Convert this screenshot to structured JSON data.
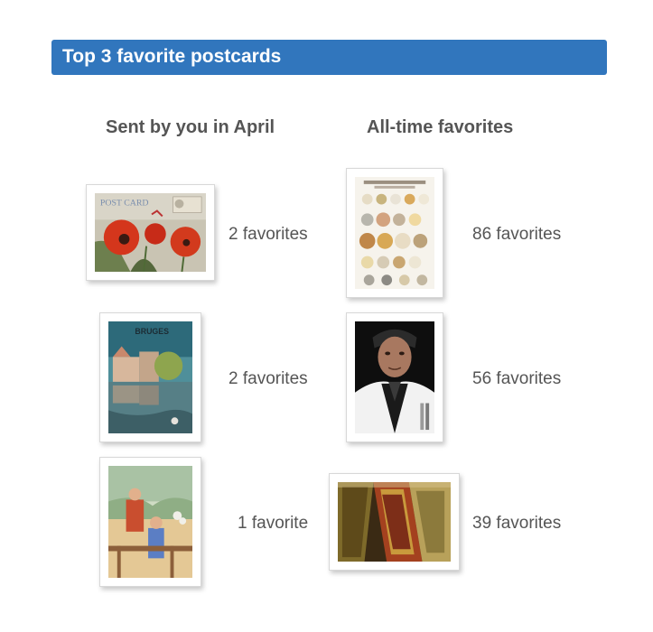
{
  "section": {
    "title": "Top 3 favorite postcards"
  },
  "columns": {
    "sent": {
      "heading": "Sent by you in April",
      "cards": [
        {
          "image": "poppies-postcard",
          "favorites": "2 favorites"
        },
        {
          "image": "bruges-canal-postcard",
          "favorites": "2 favorites"
        },
        {
          "image": "children-painting-postcard",
          "favorites": "1 favorite"
        }
      ]
    },
    "alltime": {
      "heading": "All-time favorites",
      "cards": [
        {
          "image": "cheese-chart-postcard",
          "favorites": "86 favorites"
        },
        {
          "image": "actor-portrait-postcard",
          "favorites": "56 favorites"
        },
        {
          "image": "abstract-frames-postcard",
          "favorites": "39 favorites"
        }
      ]
    }
  },
  "colors": {
    "header_bar": "#3176bd",
    "text": "#555555"
  }
}
